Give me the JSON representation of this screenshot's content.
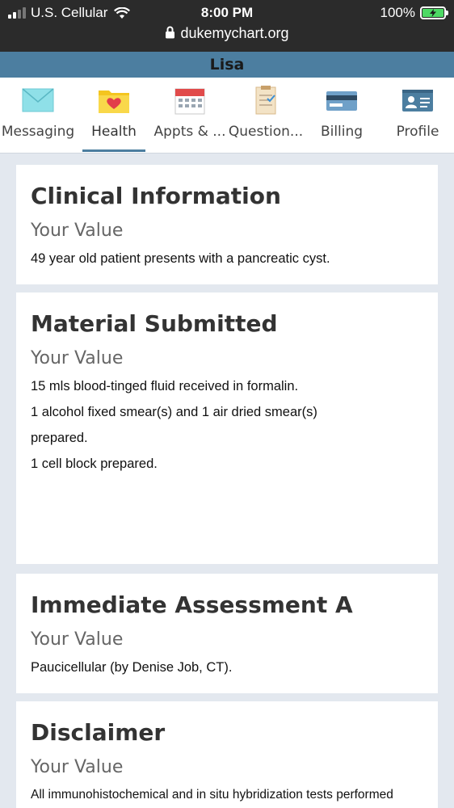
{
  "status_bar": {
    "carrier": "U.S. Cellular",
    "time": "8:00 PM",
    "battery": "100%",
    "url": "dukemychart.org"
  },
  "patient_name": "Lisa",
  "nav": [
    {
      "label": "Messaging",
      "icon": "envelope-icon"
    },
    {
      "label": "Health",
      "icon": "folder-heart-icon",
      "active": true
    },
    {
      "label": "Appts & ...",
      "icon": "calendar-icon"
    },
    {
      "label": "Question...",
      "icon": "clipboard-icon"
    },
    {
      "label": "Billing",
      "icon": "credit-card-icon"
    },
    {
      "label": "Profile",
      "icon": "id-card-icon"
    }
  ],
  "cards": [
    {
      "title": "Clinical Information",
      "subtitle": "Your Value",
      "lines": [
        "49 year old patient presents with a pancreatic cyst."
      ]
    },
    {
      "title": "Material Submitted",
      "subtitle": "Your Value",
      "lines": [
        "15 mls blood-tinged fluid received in formalin.",
        "1 alcohol fixed smear(s) and 1 air dried smear(s)",
        "prepared.",
        "1 cell block prepared."
      ]
    },
    {
      "title": "Immediate Assessment A",
      "subtitle": "Your Value",
      "lines": [
        "Paucicellular (by Denise Job, CT)."
      ]
    },
    {
      "title": "Disclaimer",
      "subtitle": "Your Value",
      "lines": [
        "All immunohistochemical and in situ hybridization tests performed"
      ]
    }
  ],
  "colors": {
    "accent": "#4c7ea0",
    "background": "#e3e8ef",
    "statusbar": "#2b2b2b"
  }
}
